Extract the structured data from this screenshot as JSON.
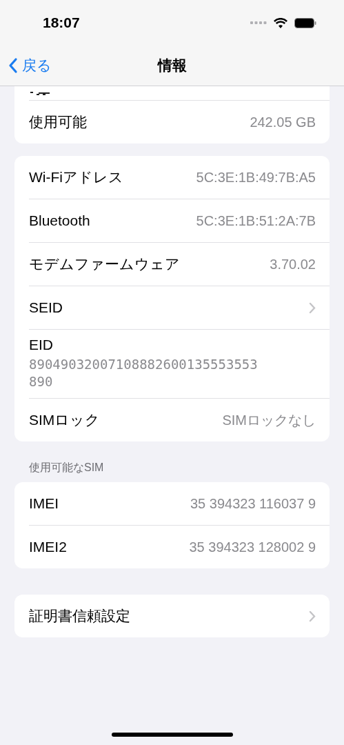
{
  "status_bar": {
    "time": "18:07"
  },
  "nav": {
    "back": "戻る",
    "title": "情報"
  },
  "groups": [
    {
      "cut_top": true,
      "rows": [
        {
          "kind": "value",
          "label": "使用可能",
          "value": "242.05 GB"
        }
      ]
    },
    {
      "rows": [
        {
          "kind": "value",
          "label": "Wi-Fiアドレス",
          "value": "5C:3E:1B:49:7B:A5"
        },
        {
          "kind": "value",
          "label": "Bluetooth",
          "value": "5C:3E:1B:51:2A:7B"
        },
        {
          "kind": "value",
          "label": "モデムファームウェア",
          "value": "3.70.02"
        },
        {
          "kind": "link",
          "label": "SEID"
        },
        {
          "kind": "stacked",
          "label": "EID",
          "value": "89049032007108882600135553553890"
        },
        {
          "kind": "value",
          "label": "SIMロック",
          "value": "SIMロックなし"
        }
      ]
    },
    {
      "header": "使用可能なSIM",
      "rows": [
        {
          "kind": "value",
          "label": "IMEI",
          "value": "35 394323 116037 9"
        },
        {
          "kind": "value",
          "label": "IMEI2",
          "value": "35 394323 128002 9"
        }
      ]
    },
    {
      "rows": [
        {
          "kind": "link",
          "label": "証明書信頼設定"
        }
      ]
    }
  ]
}
